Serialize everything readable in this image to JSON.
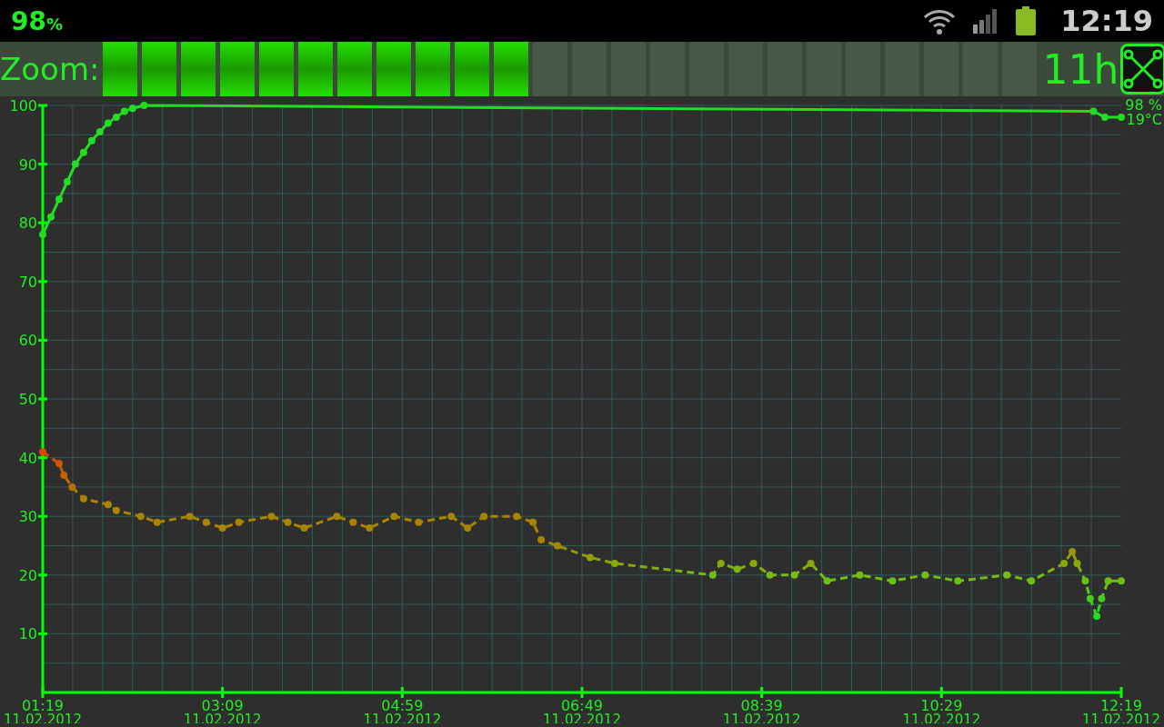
{
  "status_bar": {
    "battery_percent": "98",
    "percent_sign": "%",
    "time": "12:19"
  },
  "zoom_bar": {
    "label": "Zoom:",
    "level": 0.4583,
    "span": "11h"
  },
  "chart": {
    "current_level": "98 %",
    "current_temp": "19°C",
    "tick_dates": [
      "11.02.2012",
      "11.02.2012",
      "11.02.2012",
      "11.02.2012",
      "11.02.2012",
      "11.02.2012",
      "11.02.2012"
    ],
    "chart_data": {
      "type": "line",
      "grid": true,
      "xlim": [
        79,
        739
      ],
      "ylim": [
        0,
        100
      ],
      "xticks": [
        {
          "value": 79,
          "label": "01:19"
        },
        {
          "value": 189,
          "label": "03:09"
        },
        {
          "value": 299,
          "label": "04:59"
        },
        {
          "value": 409,
          "label": "06:49"
        },
        {
          "value": 519,
          "label": "08:39"
        },
        {
          "value": 629,
          "label": "10:29"
        },
        {
          "value": 739,
          "label": "12:19"
        }
      ],
      "yticks": [
        10,
        20,
        30,
        40,
        50,
        60,
        70,
        80,
        90,
        100
      ],
      "series": [
        {
          "color": "#22dd22",
          "marker": "o",
          "line_style": "solid",
          "x": [
            79,
            84,
            89,
            94,
            99,
            104,
            109,
            114,
            119,
            124,
            129,
            134,
            141,
            722,
            729,
            739
          ],
          "values": [
            78,
            81,
            84,
            87,
            90,
            92,
            94,
            95.5,
            97,
            98,
            99,
            99.5,
            100,
            99,
            98,
            98
          ]
        },
        {
          "color": "#a88400",
          "marker": "o",
          "line_style": "dashed",
          "x": [
            79,
            89,
            92,
            97,
            104,
            119,
            124,
            139,
            149,
            169,
            179,
            189,
            199,
            219,
            229,
            239,
            259,
            269,
            279,
            294,
            309,
            329,
            339,
            349,
            369,
            379,
            384,
            394,
            414,
            429,
            489,
            494,
            504,
            514,
            524,
            539,
            549,
            559,
            579,
            599,
            619,
            639,
            669,
            684,
            704,
            709,
            712,
            717,
            720,
            724,
            727,
            731,
            739
          ],
          "values": [
            41,
            39,
            37,
            35,
            33,
            32,
            31,
            30,
            29,
            30,
            29,
            28,
            29,
            30,
            29,
            28,
            30,
            29,
            28,
            30,
            29,
            30,
            28,
            30,
            30,
            29,
            26,
            25,
            23,
            22,
            20,
            22,
            21,
            22,
            20,
            20,
            22,
            19,
            20,
            19,
            20,
            19,
            20,
            19,
            22,
            24,
            22,
            19,
            16,
            13,
            16,
            19,
            19
          ]
        }
      ]
    }
  }
}
